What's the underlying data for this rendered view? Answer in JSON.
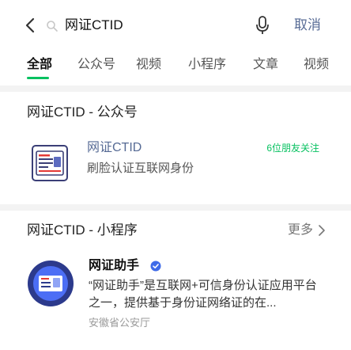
{
  "search": {
    "query": "网证CTID",
    "cancel_label": "取消"
  },
  "tabs": [
    {
      "label": "全部"
    },
    {
      "label": "公众号"
    },
    {
      "label": "视频"
    },
    {
      "label": "小程序"
    },
    {
      "label": "文章"
    },
    {
      "label": "视频"
    }
  ],
  "accounts_section": {
    "title": "网证CTID - 公众号",
    "item": {
      "name": "网证CTID",
      "description": "刷脸认证互联网身份",
      "badge": "6位朋友关注"
    }
  },
  "mini_section": {
    "title": "网证CTID - 小程序",
    "more_label": "更多",
    "item": {
      "name": "网证助手",
      "description": "“网证助手”是互联网+可信身份认证应用平台之一，提供基于身份证网络证的在...",
      "source": "安徽省公安厅"
    }
  },
  "colors": {
    "accent_green": "#07c160",
    "link_blue": "#576b95",
    "section_bg": "#f3f3f3"
  }
}
